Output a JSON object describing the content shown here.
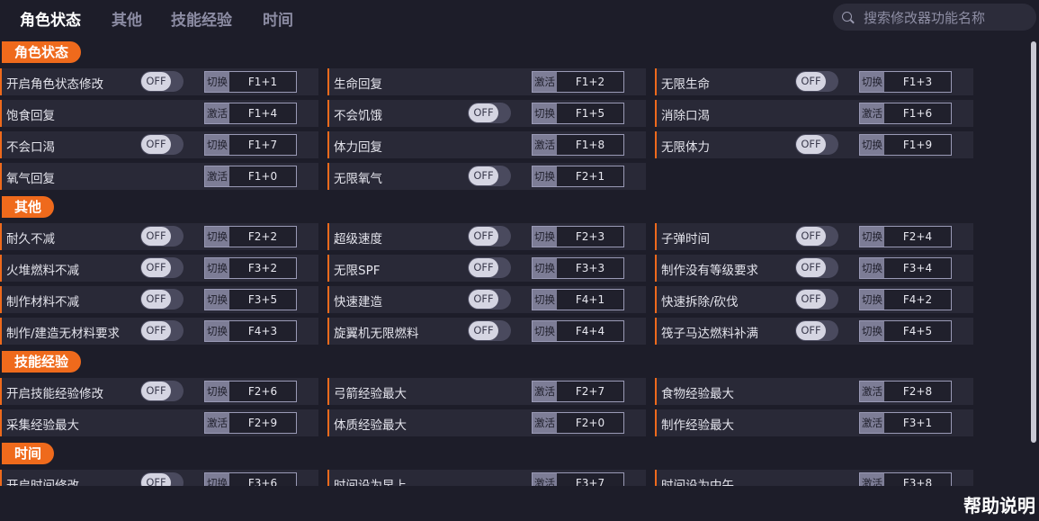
{
  "tabs": [
    "角色状态",
    "其他",
    "技能经验",
    "时间"
  ],
  "active_tab": 0,
  "search": {
    "placeholder": "搜索修改器功能名称",
    "icon": "search-icon"
  },
  "toggle_off_label": "OFF",
  "help_label": "帮助说明",
  "accent_color": "#ef6a1c",
  "sections": [
    {
      "title": "角色状态",
      "rows": [
        [
          {
            "label": "开启角色状态修改",
            "toggle": true,
            "action": "切换",
            "key": "F1+1"
          },
          {
            "label": "生命回复",
            "toggle": false,
            "action": "激活",
            "key": "F1+2"
          },
          {
            "label": "无限生命",
            "toggle": true,
            "action": "切换",
            "key": "F1+3"
          }
        ],
        [
          {
            "label": "饱食回复",
            "toggle": false,
            "action": "激活",
            "key": "F1+4"
          },
          {
            "label": "不会饥饿",
            "toggle": true,
            "action": "切换",
            "key": "F1+5"
          },
          {
            "label": "消除口渴",
            "toggle": false,
            "action": "激活",
            "key": "F1+6"
          }
        ],
        [
          {
            "label": "不会口渴",
            "toggle": true,
            "action": "切换",
            "key": "F1+7"
          },
          {
            "label": "体力回复",
            "toggle": false,
            "action": "激活",
            "key": "F1+8"
          },
          {
            "label": "无限体力",
            "toggle": true,
            "action": "切换",
            "key": "F1+9"
          }
        ],
        [
          {
            "label": "氧气回复",
            "toggle": false,
            "action": "激活",
            "key": "F1+0"
          },
          {
            "label": "无限氧气",
            "toggle": true,
            "action": "切换",
            "key": "F2+1"
          }
        ]
      ]
    },
    {
      "title": "其他",
      "rows": [
        [
          {
            "label": "耐久不减",
            "toggle": true,
            "action": "切换",
            "key": "F2+2"
          },
          {
            "label": "超级速度",
            "toggle": true,
            "action": "切换",
            "key": "F2+3"
          },
          {
            "label": "子弹时间",
            "toggle": true,
            "action": "切换",
            "key": "F2+4"
          }
        ],
        [
          {
            "label": "火堆燃料不减",
            "toggle": true,
            "action": "切换",
            "key": "F3+2"
          },
          {
            "label": "无限SPF",
            "toggle": true,
            "action": "切换",
            "key": "F3+3"
          },
          {
            "label": "制作没有等级要求",
            "toggle": true,
            "action": "切换",
            "key": "F3+4"
          }
        ],
        [
          {
            "label": "制作材料不减",
            "toggle": true,
            "action": "切换",
            "key": "F3+5"
          },
          {
            "label": "快速建造",
            "toggle": true,
            "action": "切换",
            "key": "F4+1"
          },
          {
            "label": "快速拆除/砍伐",
            "toggle": true,
            "action": "切换",
            "key": "F4+2"
          }
        ],
        [
          {
            "label": "制作/建造无材料要求",
            "toggle": true,
            "action": "切换",
            "key": "F4+3"
          },
          {
            "label": "旋翼机无限燃料",
            "toggle": true,
            "action": "切换",
            "key": "F4+4"
          },
          {
            "label": "筏子马达燃料补满",
            "toggle": true,
            "action": "切换",
            "key": "F4+5"
          }
        ]
      ]
    },
    {
      "title": "技能经验",
      "rows": [
        [
          {
            "label": "开启技能经验修改",
            "toggle": true,
            "action": "切换",
            "key": "F2+6"
          },
          {
            "label": "弓箭经验最大",
            "toggle": false,
            "action": "激活",
            "key": "F2+7"
          },
          {
            "label": "食物经验最大",
            "toggle": false,
            "action": "激活",
            "key": "F2+8"
          }
        ],
        [
          {
            "label": "采集经验最大",
            "toggle": false,
            "action": "激活",
            "key": "F2+9"
          },
          {
            "label": "体质经验最大",
            "toggle": false,
            "action": "激活",
            "key": "F2+0"
          },
          {
            "label": "制作经验最大",
            "toggle": false,
            "action": "激活",
            "key": "F3+1"
          }
        ]
      ]
    },
    {
      "title": "时间",
      "rows": [
        [
          {
            "label": "开启时间修改",
            "toggle": true,
            "action": "切换",
            "key": "F3+6"
          },
          {
            "label": "时间设为早上",
            "toggle": false,
            "action": "激活",
            "key": "F3+7"
          },
          {
            "label": "时间设为中午",
            "toggle": false,
            "action": "激活",
            "key": "F3+8"
          }
        ]
      ]
    }
  ]
}
